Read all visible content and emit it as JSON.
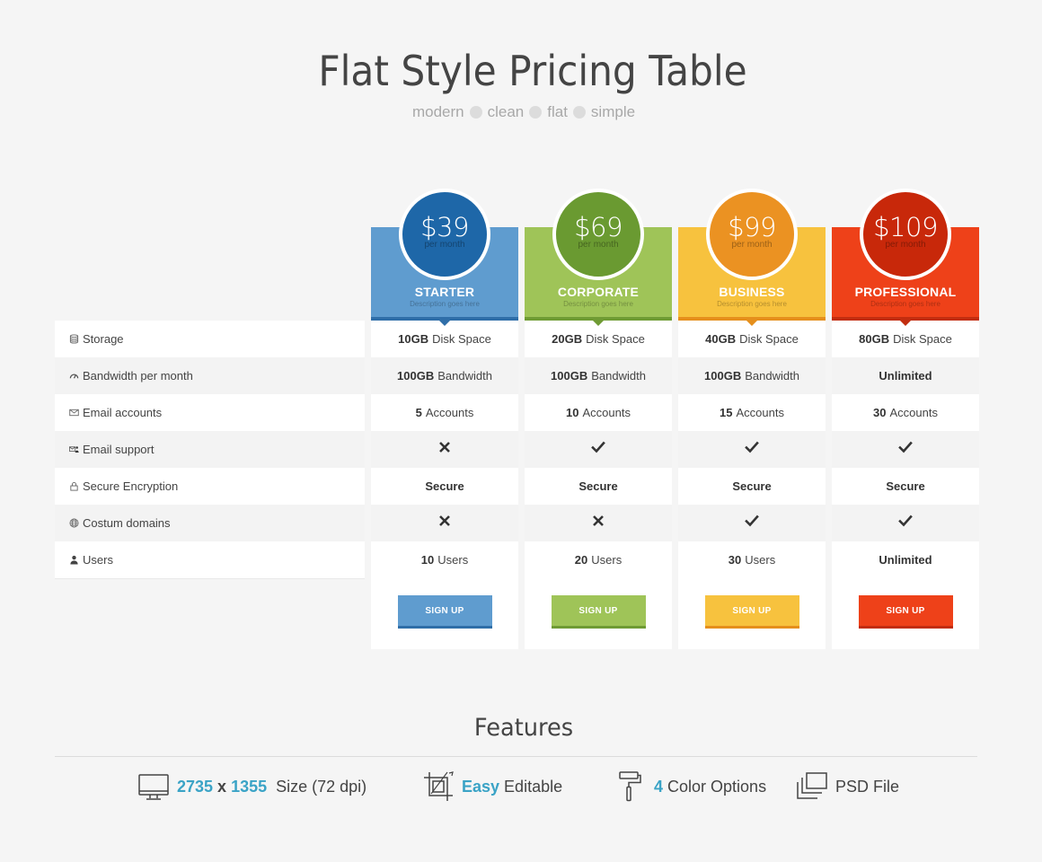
{
  "header": {
    "title": "Flat Style Pricing Table",
    "tags": [
      "modern",
      "clean",
      "flat",
      "simple"
    ]
  },
  "features_list": [
    {
      "label": "Storage",
      "icon": "storage-icon"
    },
    {
      "label": "Bandwidth per month",
      "icon": "gauge-icon"
    },
    {
      "label": "Email accounts",
      "icon": "envelope-icon"
    },
    {
      "label": "Email support",
      "icon": "email-support-icon"
    },
    {
      "label": "Secure Encryption",
      "icon": "lock-icon"
    },
    {
      "label": "Costum domains",
      "icon": "globe-icon"
    },
    {
      "label": "Users",
      "icon": "user-icon"
    }
  ],
  "plans": [
    {
      "name": "STARTER",
      "price": "$39",
      "period": "per month",
      "description": "Description goes here",
      "color": "#5f9ccf",
      "dark": "#1e67a8",
      "bar": "#2f6ea8",
      "cells": [
        {
          "bold": "10GB",
          "text": "Disk Space"
        },
        {
          "bold": "100GB",
          "text": "Bandwidth"
        },
        {
          "bold": "5",
          "text": "Accounts"
        },
        {
          "mark": "cross"
        },
        {
          "bold": "Secure",
          "text": ""
        },
        {
          "mark": "cross"
        },
        {
          "bold": "10",
          "text": "Users"
        }
      ],
      "button": "SIGN UP"
    },
    {
      "name": "CORPORATE",
      "price": "$69",
      "period": "per month",
      "description": "Description goes here",
      "color": "#9fc458",
      "dark": "#6a9a31",
      "bar": "#6f9b34",
      "cells": [
        {
          "bold": "20GB",
          "text": "Disk Space"
        },
        {
          "bold": "100GB",
          "text": "Bandwidth"
        },
        {
          "bold": "10",
          "text": "Accounts"
        },
        {
          "mark": "check"
        },
        {
          "bold": "Secure",
          "text": ""
        },
        {
          "mark": "cross"
        },
        {
          "bold": "20",
          "text": "Users"
        }
      ],
      "button": "SIGN UP"
    },
    {
      "name": "BUSINESS",
      "price": "$99",
      "period": "per month",
      "description": "Description goes here",
      "color": "#f7c23e",
      "dark": "#eb9222",
      "bar": "#e58f1c",
      "cells": [
        {
          "bold": "40GB",
          "text": "Disk Space"
        },
        {
          "bold": "100GB",
          "text": "Bandwidth"
        },
        {
          "bold": "15",
          "text": "Accounts"
        },
        {
          "mark": "check"
        },
        {
          "bold": "Secure",
          "text": ""
        },
        {
          "mark": "check"
        },
        {
          "bold": "30",
          "text": "Users"
        }
      ],
      "button": "SIGN UP"
    },
    {
      "name": "PROFESSIONAL",
      "price": "$109",
      "period": "per month",
      "description": "Description goes here",
      "color": "#ee4119",
      "dark": "#c8280a",
      "bar": "#c22d0f",
      "cells": [
        {
          "bold": "80GB",
          "text": "Disk Space"
        },
        {
          "bold": "Unlimited",
          "text": ""
        },
        {
          "bold": "30",
          "text": "Accounts"
        },
        {
          "mark": "check"
        },
        {
          "bold": "Secure",
          "text": ""
        },
        {
          "mark": "check"
        },
        {
          "bold": "Unlimited",
          "text": ""
        }
      ],
      "button": "SIGN UP"
    }
  ],
  "features_section": {
    "title": "Features",
    "items": [
      {
        "icon": "monitor-icon",
        "parts": [
          {
            "t": "2735",
            "accent": true
          },
          {
            "t": " x ",
            "accent": false,
            "bold": true
          },
          {
            "t": "1355",
            "accent": true
          },
          {
            "t": "  Size (72 dpi)",
            "accent": false
          }
        ]
      },
      {
        "icon": "crop-icon",
        "parts": [
          {
            "t": "Easy",
            "accent": true
          },
          {
            "t": " Editable",
            "accent": false
          }
        ]
      },
      {
        "icon": "paint-roller-icon",
        "parts": [
          {
            "t": "4",
            "accent": true
          },
          {
            "t": " Color Options",
            "accent": false
          }
        ]
      },
      {
        "icon": "layers-icon",
        "parts": [
          {
            "t": "PSD File",
            "accent": false
          }
        ]
      }
    ]
  },
  "colors": {
    "accent": "#3aa3c6",
    "background": "#f5f5f5"
  }
}
